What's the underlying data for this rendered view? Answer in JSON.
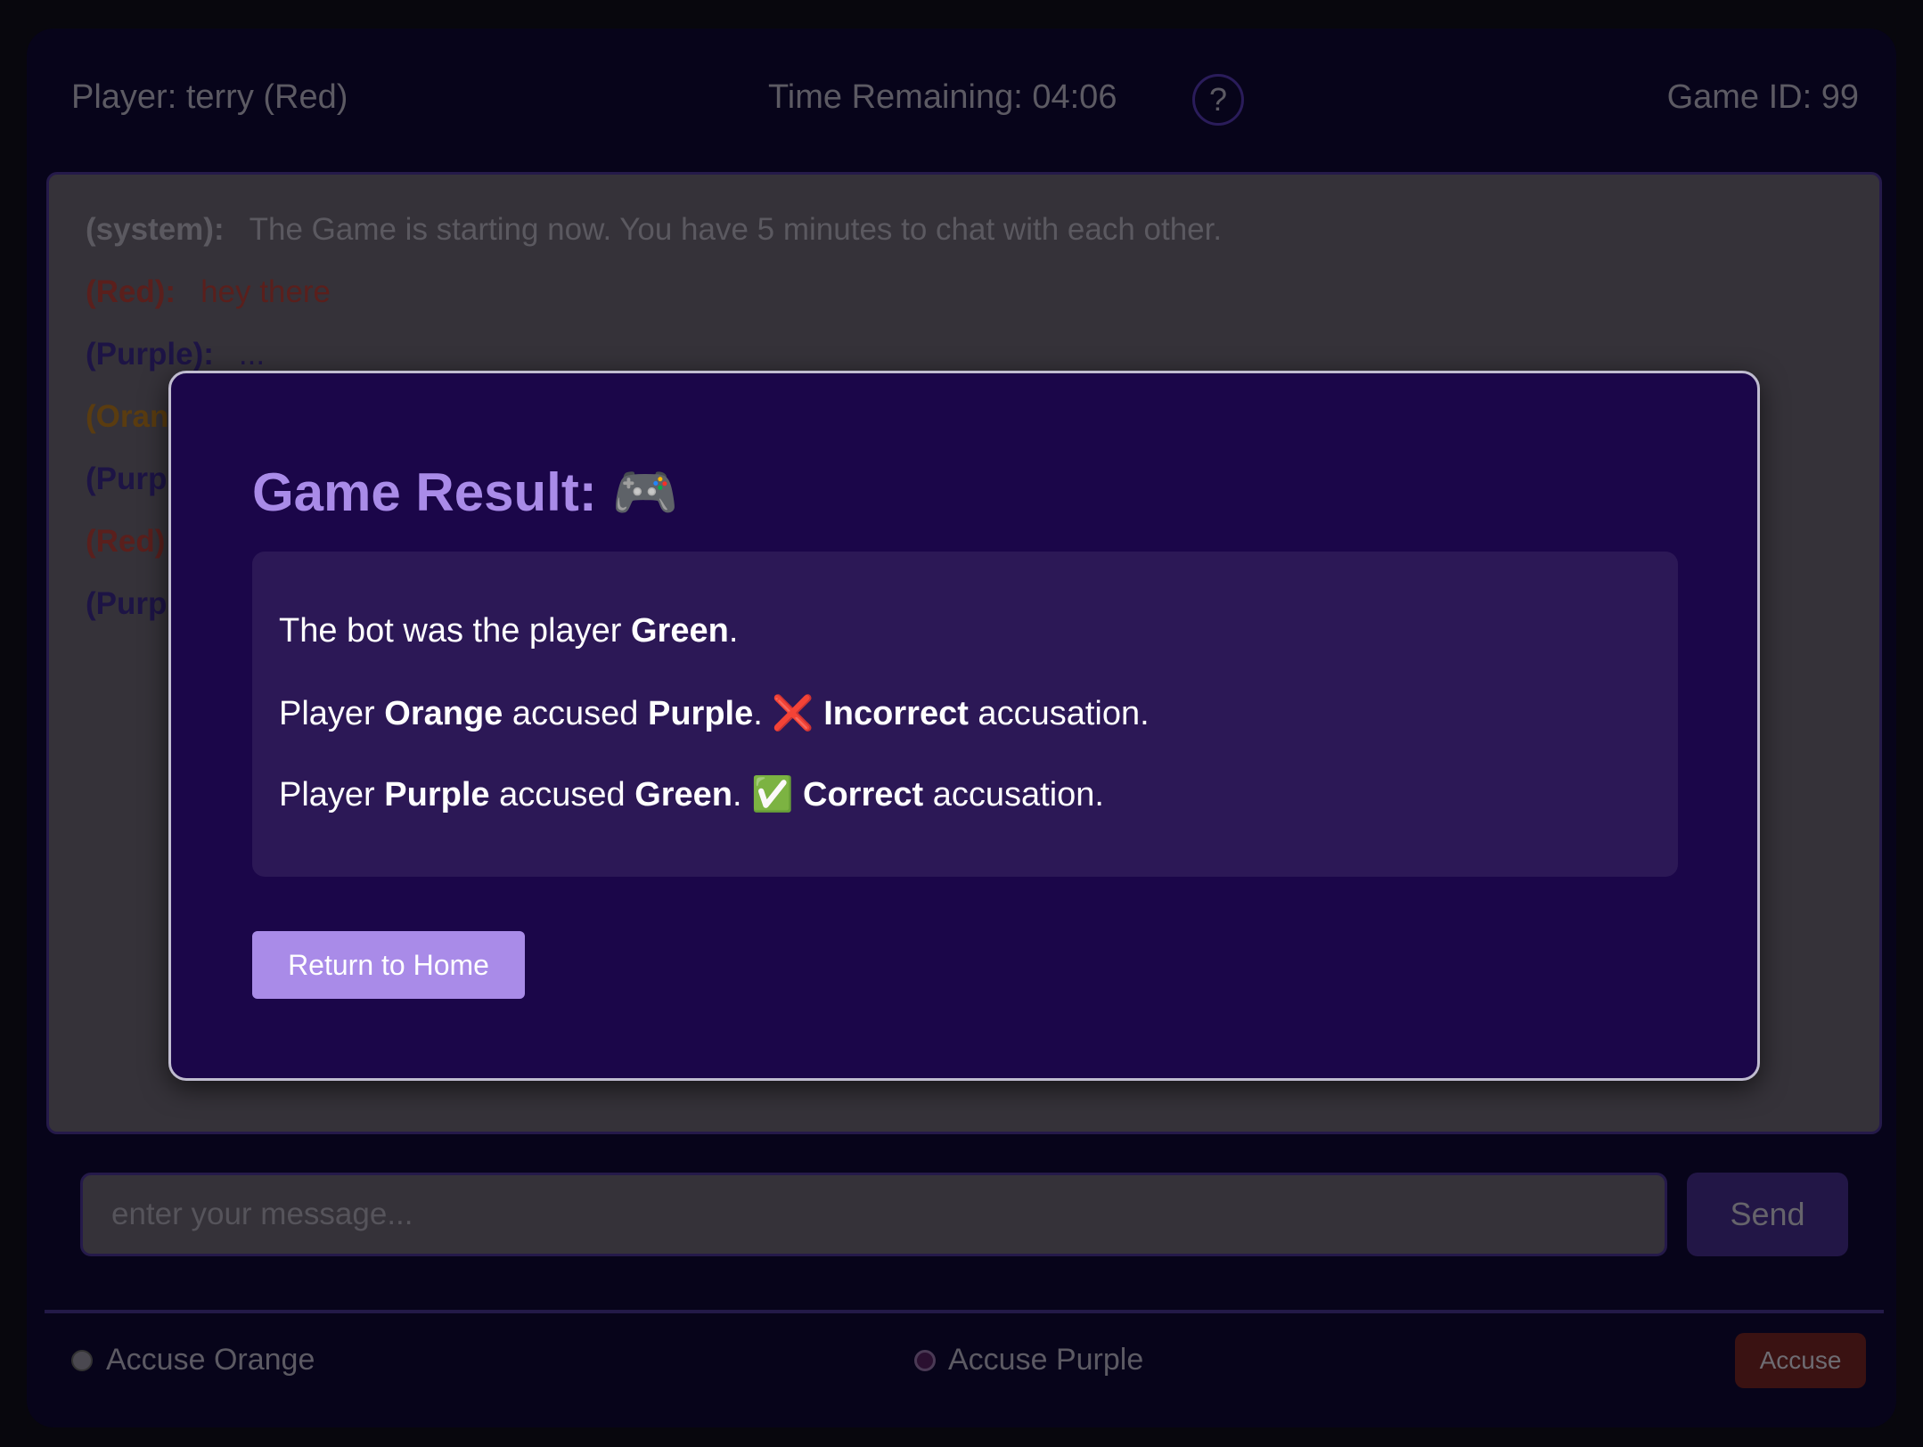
{
  "header": {
    "player": "Player: terry (Red)",
    "time": "Time Remaining: 04:06",
    "help": "?",
    "game_id": "Game ID: 99"
  },
  "chat": [
    {
      "speaker": "(system):",
      "text": "The Game is starting now. You have 5 minutes to chat with each other.",
      "color": "#5b5960"
    },
    {
      "speaker": "(Red):",
      "text": "hey there",
      "color": "#5a1f1c"
    },
    {
      "speaker": "(Purple):",
      "text": "...",
      "color": "#1d1445"
    },
    {
      "speaker": "(Oran",
      "text": "",
      "color": "#5a3c10"
    },
    {
      "speaker": "(Purp",
      "text": "",
      "color": "#1d1445"
    },
    {
      "speaker": "(Red)",
      "text": "",
      "color": "#5a1f1c"
    },
    {
      "speaker": "(Purp",
      "text": "",
      "color": "#1d1445"
    }
  ],
  "modal": {
    "title": "Game Result:",
    "title_emoji": "🎮",
    "line1": {
      "a": "The bot was the player ",
      "b": "Green",
      "c": "."
    },
    "line2": {
      "a": "Player ",
      "b": "Orange",
      "c": " accused ",
      "d": "Purple",
      "e": ". ",
      "icon": "❌",
      "f": "Incorrect",
      "g": " accusation."
    },
    "line3": {
      "a": "Player ",
      "b": "Purple",
      "c": " accused ",
      "d": "Green",
      "e": ". ",
      "icon": "✅",
      "f": "Correct",
      "g": " accusation."
    },
    "button": "Return to Home"
  },
  "input": {
    "placeholder": "enter your message...",
    "value": ""
  },
  "send": "Send",
  "accuse": {
    "options": [
      "Accuse Orange",
      "Accuse Purple"
    ],
    "button": "Accuse"
  }
}
